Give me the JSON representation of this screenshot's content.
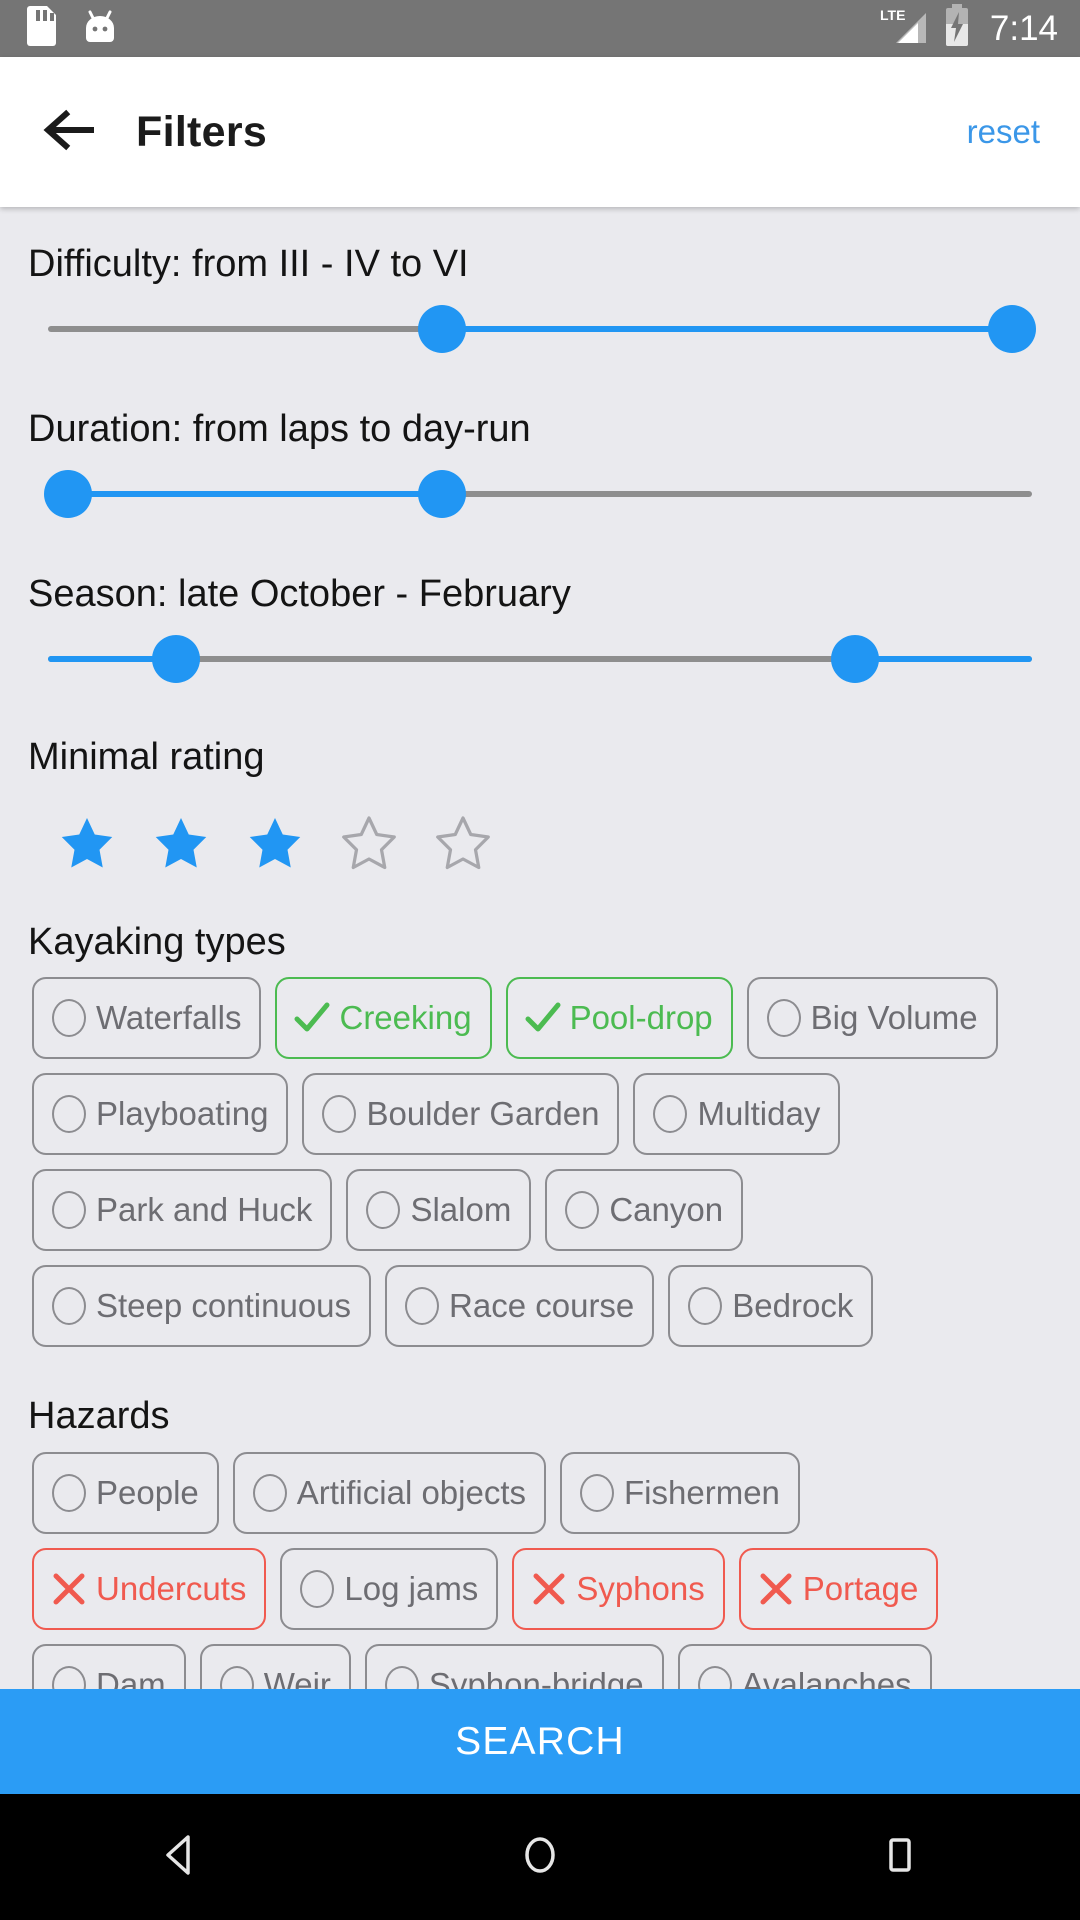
{
  "statusbar": {
    "icons": [
      "sd-card-icon",
      "android-head-icon"
    ],
    "network": "LTE",
    "battery": "charging",
    "time": "7:14"
  },
  "appbar": {
    "back_icon": "arrow-left-icon",
    "title": "Filters",
    "reset_label": "reset"
  },
  "filters": {
    "difficulty": {
      "label": "Difficulty: from III - IV to VI",
      "low_pct": 40,
      "high_pct": 98,
      "inverted": false
    },
    "duration": {
      "label": "Duration: from laps to day-run",
      "low_pct": 2,
      "high_pct": 40,
      "inverted": false
    },
    "season": {
      "label": "Season: late October - February",
      "low_pct": 13,
      "high_pct": 82,
      "inverted": true
    },
    "rating": {
      "label": "Minimal rating",
      "value": 3,
      "max": 5
    },
    "kayaking_types": {
      "label": "Kayaking types",
      "rows": [
        [
          {
            "label": "Waterfalls",
            "state": "none"
          },
          {
            "label": "Creeking",
            "state": "include"
          },
          {
            "label": "Pool-drop",
            "state": "include"
          },
          {
            "label": "Big Volume",
            "state": "none"
          }
        ],
        [
          {
            "label": "Playboating",
            "state": "none"
          },
          {
            "label": "Boulder Garden",
            "state": "none"
          },
          {
            "label": "Multiday",
            "state": "none"
          }
        ],
        [
          {
            "label": "Park and Huck",
            "state": "none"
          },
          {
            "label": "Slalom",
            "state": "none"
          },
          {
            "label": "Canyon",
            "state": "none"
          }
        ],
        [
          {
            "label": "Steep continuous",
            "state": "none"
          },
          {
            "label": "Race course",
            "state": "none"
          },
          {
            "label": "Bedrock",
            "state": "none"
          }
        ]
      ]
    },
    "hazards": {
      "label": "Hazards",
      "rows": [
        [
          {
            "label": "People",
            "state": "none"
          },
          {
            "label": "Artificial objects",
            "state": "none"
          },
          {
            "label": "Fishermen",
            "state": "none"
          }
        ],
        [
          {
            "label": "Undercuts",
            "state": "exclude"
          },
          {
            "label": "Log jams",
            "state": "none"
          },
          {
            "label": "Syphons",
            "state": "exclude"
          },
          {
            "label": "Portage",
            "state": "exclude"
          }
        ],
        [
          {
            "label": "Dam",
            "state": "none"
          },
          {
            "label": "Weir",
            "state": "none"
          },
          {
            "label": "Syphon-bridge",
            "state": "none"
          },
          {
            "label": "Avalanches",
            "state": "none"
          }
        ]
      ]
    }
  },
  "search_button": {
    "label": "SEARCH"
  },
  "navbar": {
    "back": "nav-back-icon",
    "home": "nav-home-icon",
    "recents": "nav-recents-icon"
  },
  "colors": {
    "accent_blue": "#2196f3",
    "search_blue": "#2b9cf5",
    "link_blue": "#3b97e8",
    "include_green": "#4cbb51",
    "exclude_red": "#f05a4f",
    "chip_border": "#8c8c90",
    "chip_text": "#6d6d72",
    "background": "#eaeaee",
    "statusbar": "#757575"
  }
}
